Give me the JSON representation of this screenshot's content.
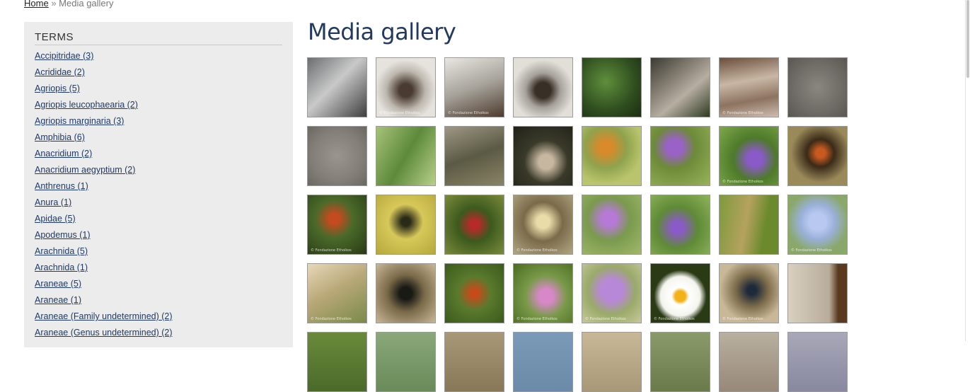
{
  "breadcrumb": {
    "home": "Home",
    "separator": "»",
    "current": "Media gallery"
  },
  "sidebar": {
    "title": "TERMS",
    "terms": [
      "Accipitridae (3)",
      "Acrididae (2)",
      "Agriopis (5)",
      "Agriopis leucophaearia (2)",
      "Agriopis marginaria (3)",
      "Amphibia (6)",
      "Anacridium (2)",
      "Anacridium aegyptium (2)",
      "Anthrenus (1)",
      "Anura (1)",
      "Apidae (5)",
      "Apodemus (1)",
      "Arachnida (5)",
      "Arachnida (1)",
      "Araneae (5)",
      "Araneae (1)",
      "Araneae (Family undetermined) (2)",
      "Araneae (Genus undetermined) (2)"
    ]
  },
  "main": {
    "title": "Media gallery"
  },
  "watermark": "© Fondazione Ethoikos",
  "gallery": {
    "rows": [
      [
        {
          "name": "moth-on-window-thumb",
          "bg": "linear-gradient(135deg,#6b6e70,#c9c9c9 45%,#3f3f3f)",
          "tag": false
        },
        {
          "name": "lizard-on-glass-thumb",
          "bg": "radial-gradient(circle at 50% 55%,#4a3b30 15%,#bdb7ae 45%,#e6e3de 70%)",
          "tag": true
        },
        {
          "name": "newt-in-jar-thumb",
          "bg": "linear-gradient(160deg,#e9e7e2,#a7a39b 50%,#4e3b2d)",
          "tag": true
        },
        {
          "name": "newt-on-glass-thumb",
          "bg": "radial-gradient(circle at 50% 55%,#3a2f26 18%,#a6a29a 40%,#e2dfd9 70%)",
          "tag": false
        },
        {
          "name": "green-plant-thumb",
          "bg": "radial-gradient(circle at 40% 40%,#5f8f3c,#2f4d1f 60%,#1c2d12)",
          "tag": false
        },
        {
          "name": "rock-thumb",
          "bg": "linear-gradient(140deg,#3b3b33,#8d8579 40%,#b7aea2 60%,#2f3b22)",
          "tag": false
        },
        {
          "name": "stone-wall-thumb",
          "bg": "linear-gradient(170deg,#6a4f3b,#c9b7a6 40%,#8d7360 70%,#cdbdb0)",
          "tag": true
        },
        {
          "name": "grey-moth-thumb",
          "bg": "radial-gradient(circle,#8a8780,#6e6b66 60%,#5a5752)",
          "tag": false
        }
      ],
      [
        {
          "name": "grey-moth-2-thumb",
          "bg": "radial-gradient(circle,#9a968e,#837f78 60%,#6a6760)",
          "tag": false
        },
        {
          "name": "grass-insect-thumb",
          "bg": "linear-gradient(120deg,#a7c27a,#5d8a3a 50%,#b8cf8a)",
          "tag": false
        },
        {
          "name": "dragonfly-thumb",
          "bg": "linear-gradient(160deg,#9e9784,#5b5a44 50%,#8a8466)",
          "tag": false
        },
        {
          "name": "rabbit-thumb",
          "bg": "radial-gradient(circle at 55% 60%,#c8b7a0 15%,#3a3a2a 45%,#202018)",
          "tag": false
        },
        {
          "name": "butterfly-orange-thumb",
          "bg": "radial-gradient(circle at 40% 35%,#d98a2a 12%,#8fa24d 40%,#b9c46c 70%)",
          "tag": false
        },
        {
          "name": "purple-flower-thumb",
          "bg": "radial-gradient(circle at 40% 35%,#9a62c6 15%,#6d8a39 40%,#98b35a)",
          "tag": false
        },
        {
          "name": "purple-flower-2-thumb",
          "bg": "radial-gradient(circle at 60% 55%,#8a5ac8 15%,#4e7a2a 45%,#7ea94a)",
          "tag": true
        },
        {
          "name": "tiger-moth-thumb",
          "bg": "radial-gradient(circle at 55% 45%,#c65a1f 10%,#3a2a18 30%,#9a8a5a 65%)",
          "tag": false
        }
      ],
      [
        {
          "name": "red-beetle-thumb",
          "bg": "radial-gradient(circle at 45% 40%,#c64a20 10%,#4a6a2a 40%,#2a3a14)",
          "tag": true
        },
        {
          "name": "owlfly-thumb",
          "bg": "radial-gradient(circle at 50% 45%,#2a2a18 10%,#d7c85a 40%,#b5a83a)",
          "tag": false
        },
        {
          "name": "burnet-moth-thumb",
          "bg": "radial-gradient(circle at 50% 50%,#b62a2a 10%,#3c5a1e 40%,#7c8a3a)",
          "tag": false
        },
        {
          "name": "swallowtail-thumb",
          "bg": "radial-gradient(circle at 50% 45%,#e8dca8 15%,#7a6a4a 45%,#b0a784)",
          "tag": true
        },
        {
          "name": "scabious-bee-thumb",
          "bg": "radial-gradient(circle at 45% 40%,#b67ad6 15%,#7a9a4e 45%,#a2b86a)",
          "tag": false
        },
        {
          "name": "scabious-wasp-thumb",
          "bg": "radial-gradient(circle at 45% 55%,#8a5ac8 12%,#5f8a36 45%,#8fb35c)",
          "tag": false
        },
        {
          "name": "brown-butterfly-thumb",
          "bg": "linear-gradient(100deg,#7e9a3c,#b5a25e 45%,#6a8a2c 75%)",
          "tag": false
        },
        {
          "name": "chicory-thumb",
          "bg": "radial-gradient(circle at 50% 45%,#b8c8f0 20%,#9ab0d8 40%,#8aa86a 70%)",
          "tag": true
        }
      ],
      [
        {
          "name": "grasshopper-thumb",
          "bg": "linear-gradient(150deg,#e8d8b8,#b8a878 45%,#7a8a4a)",
          "tag": true
        },
        {
          "name": "spotted-moth-thumb",
          "bg": "radial-gradient(circle at 50% 50%,#1a1a14 15%,#7a6a4a 45%,#c8b898)",
          "tag": false
        },
        {
          "name": "beetle-leaf-thumb",
          "bg": "radial-gradient(circle at 50% 50%,#c84a1a 8%,#5a7a2e 40%,#3a5a1a)",
          "tag": false
        },
        {
          "name": "pink-flower-thumb",
          "bg": "radial-gradient(circle at 55% 55%,#d888c8 15%,#7a9a4a 45%,#4a6a1e)",
          "tag": true
        },
        {
          "name": "scabious-beetle-thumb",
          "bg": "radial-gradient(circle at 50% 45%,#b888d8 25%,#9aaa6a 55%,#c8c89a)",
          "tag": true
        },
        {
          "name": "daisy-thumb",
          "bg": "radial-gradient(circle at 50% 55%,#f2b21a 12%,#ffffff 20%,#f4f4ee 45%,#2a3a14 60%)",
          "tag": true
        },
        {
          "name": "dung-beetle-thumb",
          "bg": "radial-gradient(circle at 55% 45%,#1e2a3a 10%,#7a6a4a 35%,#c8b898 70%)",
          "tag": true
        },
        {
          "name": "moth-on-wood-thumb",
          "bg": "linear-gradient(90deg,#d8d0c0,#b8ac9a 70%,#5a3a1e 85%)",
          "tag": false
        }
      ],
      [
        {
          "name": "row5-thumb-1",
          "bg": "linear-gradient(180deg,#6a8a3a,#4a6a2a)",
          "tag": false
        },
        {
          "name": "row5-thumb-2",
          "bg": "linear-gradient(180deg,#8aa87a,#6a8a5a)",
          "tag": false
        },
        {
          "name": "row5-thumb-3",
          "bg": "linear-gradient(180deg,#a89878,#887858)",
          "tag": false
        },
        {
          "name": "row5-thumb-4",
          "bg": "linear-gradient(180deg,#7a9ab8,#6a8aa8)",
          "tag": false
        },
        {
          "name": "row5-thumb-5",
          "bg": "linear-gradient(180deg,#c8b898,#a89878)",
          "tag": false
        },
        {
          "name": "row5-thumb-6",
          "bg": "linear-gradient(180deg,#8a9a6a,#6a7a4a)",
          "tag": false
        },
        {
          "name": "row5-thumb-7",
          "bg": "linear-gradient(180deg,#b8b0a0,#988878)",
          "tag": false
        },
        {
          "name": "row5-thumb-8",
          "bg": "linear-gradient(180deg,#a8a8b8,#8888a0)",
          "tag": false
        }
      ]
    ]
  }
}
